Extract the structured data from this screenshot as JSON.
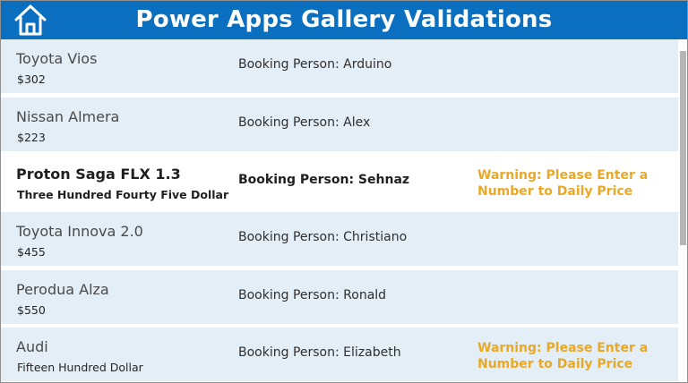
{
  "header": {
    "title": "Power Apps Gallery Validations",
    "home_icon": "home-icon",
    "background_color": "#0b6fbf"
  },
  "gallery": {
    "items": [
      {
        "name": "Toyota Vios",
        "price": "$302",
        "booking": "Booking Person: Arduino",
        "warning": "",
        "selected": false
      },
      {
        "name": "Nissan Almera",
        "price": "$223",
        "booking": "Booking Person: Alex",
        "warning": "",
        "selected": false
      },
      {
        "name": "Proton Saga FLX 1.3",
        "price": "Three Hundred Fourty Five Dollar",
        "booking": "Booking Person: Sehnaz",
        "warning": "Warning: Please Enter a Number to Daily Price",
        "selected": true
      },
      {
        "name": "Toyota Innova 2.0",
        "price": "$455",
        "booking": "Booking Person: Christiano",
        "warning": "",
        "selected": false
      },
      {
        "name": "Perodua Alza",
        "price": "$550",
        "booking": "Booking Person: Ronald",
        "warning": "",
        "selected": false
      },
      {
        "name": "Audi",
        "price": "Fifteen Hundred Dollar",
        "booking": "Booking Person: Elizabeth",
        "warning": "Warning: Please Enter a Number to Daily Price",
        "selected": false
      }
    ],
    "row_color": "#e3eef6",
    "selected_row_color": "#ffffff",
    "warning_color": "#e9a826"
  }
}
